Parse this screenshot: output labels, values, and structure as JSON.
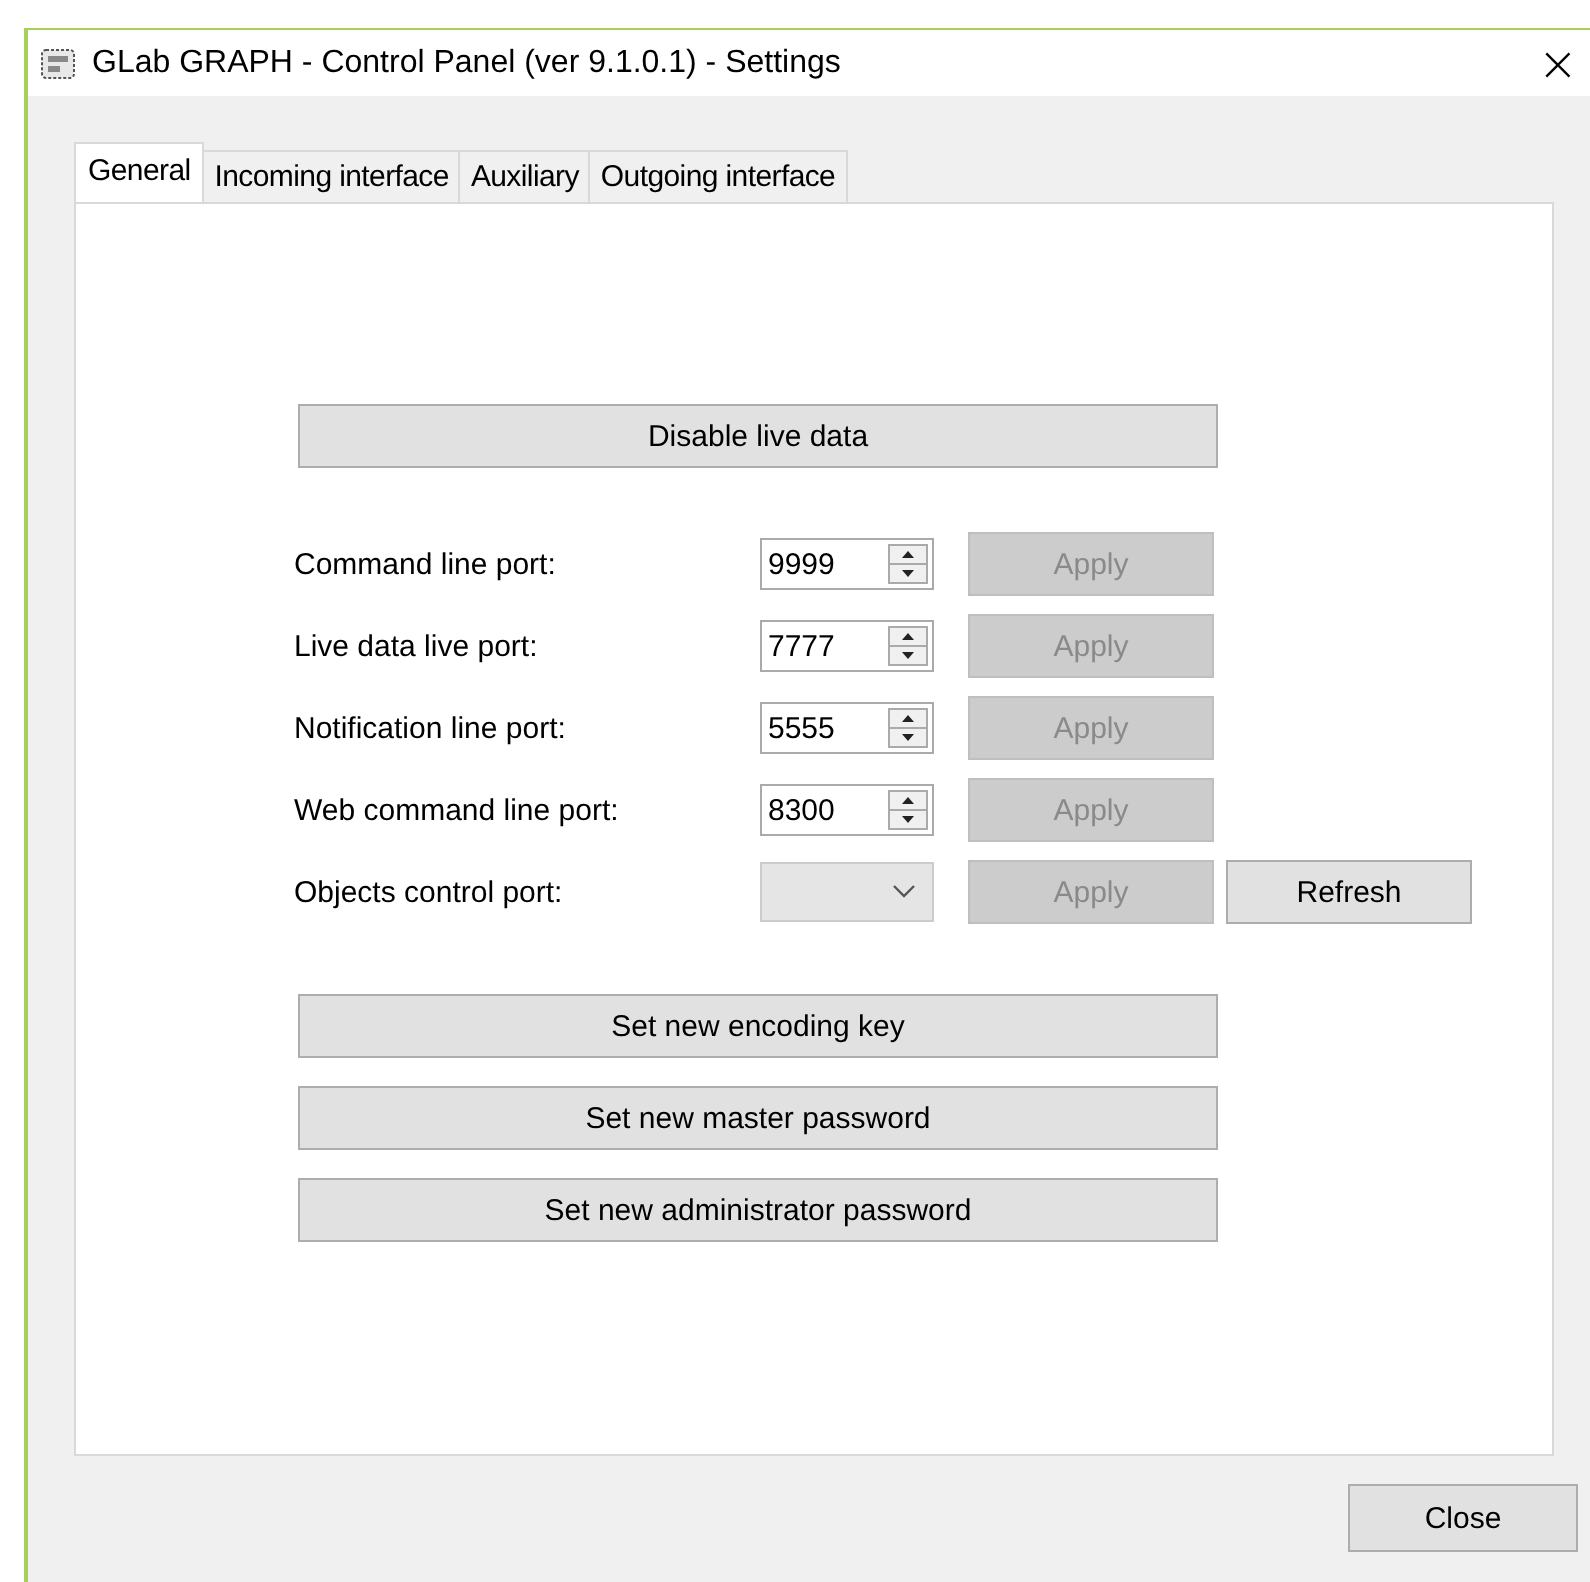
{
  "window": {
    "title": "GLab GRAPH - Control Panel (ver 9.1.0.1) - Settings",
    "close": "×"
  },
  "tabs": [
    {
      "label": "General",
      "selected": true
    },
    {
      "label": "Incoming interface",
      "selected": false
    },
    {
      "label": "Auxiliary",
      "selected": false
    },
    {
      "label": "Outgoing interface",
      "selected": false
    }
  ],
  "live_button": {
    "label": "Disable live data"
  },
  "ports": [
    {
      "kind": "spinner",
      "label": "Command line port:",
      "value": "9999",
      "apply": {
        "label": "Apply",
        "disabled": true
      }
    },
    {
      "kind": "spinner",
      "label": "Live data live port:",
      "value": "7777",
      "apply": {
        "label": "Apply",
        "disabled": true
      }
    },
    {
      "kind": "spinner",
      "label": "Notification line port:",
      "value": "5555",
      "apply": {
        "label": "Apply",
        "disabled": true
      }
    },
    {
      "kind": "spinner",
      "label": "Web command line port:",
      "value": "8300",
      "apply": {
        "label": "Apply",
        "disabled": true
      }
    },
    {
      "kind": "dropdown",
      "label": "Objects control port:",
      "disabled": true,
      "apply": {
        "label": "Apply",
        "disabled": true
      },
      "extra_button": "Refresh"
    }
  ],
  "actions": [
    "Set new encoding key",
    "Set new master password",
    "Set new administrator password"
  ],
  "footer_button": "Close"
}
